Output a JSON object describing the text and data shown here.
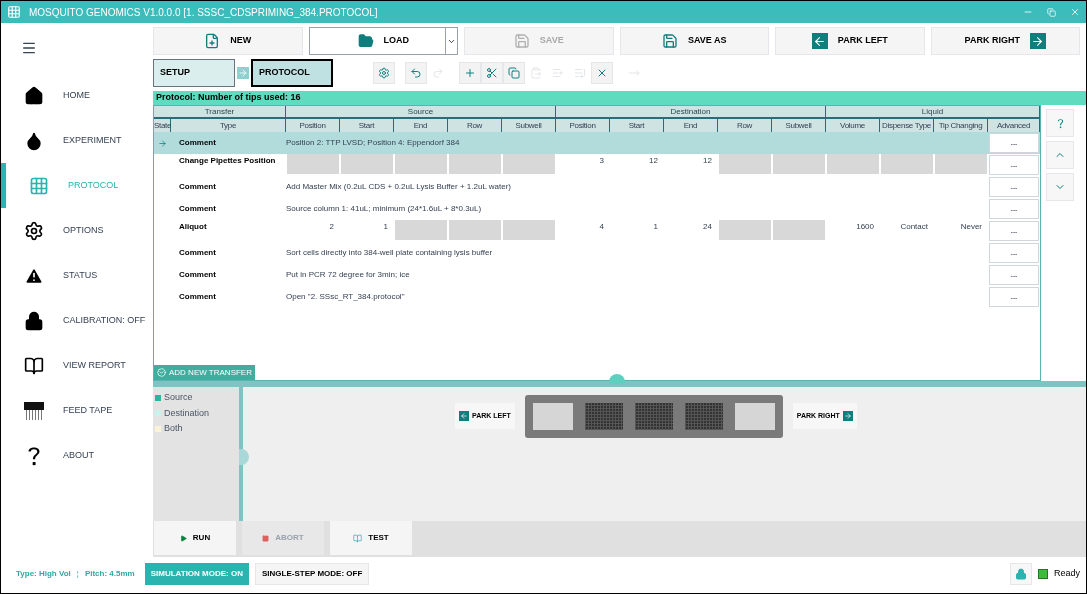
{
  "window": {
    "title": "MOSQUITO GENOMICS V1.0.0.0 [1. SSSC_CDSPRIMING_384.PROTOCOL]"
  },
  "sidebar": {
    "items": [
      {
        "label": "HOME",
        "selected": false
      },
      {
        "label": "EXPERIMENT",
        "selected": false
      },
      {
        "label": "PROTOCOL",
        "selected": true
      },
      {
        "label": "OPTIONS",
        "selected": false
      },
      {
        "label": "STATUS",
        "selected": false
      },
      {
        "label": "CALIBRATION: OFF",
        "selected": false
      },
      {
        "label": "VIEW REPORT",
        "selected": false
      },
      {
        "label": "FEED TAPE",
        "selected": false
      },
      {
        "label": "ABOUT",
        "selected": false
      }
    ]
  },
  "file_buttons": [
    {
      "label": "NEW",
      "disabled": false,
      "dropdown": false
    },
    {
      "label": "LOAD",
      "disabled": false,
      "dropdown": true
    },
    {
      "label": "SAVE",
      "disabled": true,
      "dropdown": false
    },
    {
      "label": "SAVE AS",
      "disabled": false,
      "dropdown": false
    },
    {
      "label": "PARK LEFT",
      "disabled": false,
      "dropdown": false
    },
    {
      "label": "PARK RIGHT",
      "disabled": false,
      "dropdown": false
    }
  ],
  "steps": [
    {
      "label": "SETUP",
      "selected": false
    },
    {
      "label": "PROTOCOL",
      "selected": true
    }
  ],
  "edit_tools": [
    {
      "disabled": false
    },
    {
      "disabled": false
    },
    {
      "disabled": true
    },
    {
      "disabled": false
    },
    {
      "disabled": false
    },
    {
      "disabled": false
    },
    {
      "disabled": true
    },
    {
      "disabled": true
    },
    {
      "disabled": true
    },
    {
      "disabled": false
    },
    {
      "disabled": true
    }
  ],
  "protocol": {
    "title": "Protocol: Number of tips used: 16",
    "groups": [
      "Transfer",
      "Source",
      "Destination",
      "Liquid"
    ],
    "columns": [
      "State",
      "Type",
      "Position",
      "Start",
      "End",
      "Row",
      "Subwell",
      "Position",
      "Start",
      "End",
      "Row",
      "Subwell",
      "Volume",
      "Dispense Type",
      "Tip Changing",
      "Advanced"
    ],
    "rows": [
      {
        "kind": "comment",
        "type": "Comment",
        "selected": true,
        "text": "Position 2: TTP LVSD; Position 4: Eppendorf 384",
        "advanced": "..."
      },
      {
        "kind": "transfer",
        "type": "Change Pipettes Position",
        "selected": false,
        "advanced": "...",
        "cells": [
          {
            "kind": "disabled"
          },
          {
            "kind": "disabled"
          },
          {
            "kind": "disabled"
          },
          {
            "kind": "disabled"
          },
          {
            "kind": "disabled"
          },
          {
            "kind": "value",
            "text": "3"
          },
          {
            "kind": "value",
            "text": "12"
          },
          {
            "kind": "value",
            "text": "12"
          },
          {
            "kind": "disabled"
          },
          {
            "kind": "disabled"
          },
          {
            "kind": "disabled"
          },
          {
            "kind": "disabled"
          },
          {
            "kind": "disabled"
          }
        ]
      },
      {
        "kind": "comment",
        "type": "Comment",
        "selected": false,
        "text": "Add Master Mix (0.2uL CDS + 0.2uL Lysis Buffer + 1.2uL water)",
        "advanced": "..."
      },
      {
        "kind": "comment",
        "type": "Comment",
        "selected": false,
        "text": "Source column 1: 41uL; minimum (24*1.6uL + 8*0.3uL)",
        "advanced": "..."
      },
      {
        "kind": "transfer",
        "type": "Aliquot",
        "selected": false,
        "advanced": "...",
        "cells": [
          {
            "kind": "value",
            "text": "2"
          },
          {
            "kind": "value",
            "text": "1"
          },
          {
            "kind": "disabled"
          },
          {
            "kind": "disabled"
          },
          {
            "kind": "disabled"
          },
          {
            "kind": "value",
            "text": "4"
          },
          {
            "kind": "value",
            "text": "1"
          },
          {
            "kind": "value",
            "text": "24"
          },
          {
            "kind": "disabled"
          },
          {
            "kind": "disabled"
          },
          {
            "kind": "value",
            "text": "1600"
          },
          {
            "kind": "value",
            "text": "Contact"
          },
          {
            "kind": "value",
            "text": "Never"
          }
        ]
      },
      {
        "kind": "comment",
        "type": "Comment",
        "selected": false,
        "text": "Sort cells directly into 384-well plate containing lysis buffer",
        "advanced": "..."
      },
      {
        "kind": "comment",
        "type": "Comment",
        "selected": false,
        "text": "Put in PCR 72 degree for 3min; ice",
        "advanced": "..."
      },
      {
        "kind": "comment",
        "type": "Comment",
        "selected": false,
        "text": "Open \"2. SSsc_RT_384.protocol\"",
        "advanced": "..."
      }
    ],
    "add_transfer": "ADD NEW TRANSFER"
  },
  "legend": [
    {
      "label": "Source",
      "color": "#2bb5a0"
    },
    {
      "label": "Destination",
      "color": "#c9f2ec"
    },
    {
      "label": "Both",
      "color": "#fbf3d9"
    }
  ],
  "deck": {
    "park_left": "PARK LEFT",
    "park_right": "PARK RIGHT",
    "positions": [
      {
        "kind": "empty"
      },
      {
        "kind": "plate"
      },
      {
        "kind": "plate"
      },
      {
        "kind": "plate"
      },
      {
        "kind": "empty"
      }
    ]
  },
  "run_buttons": [
    {
      "label": "RUN",
      "disabled": false
    },
    {
      "label": "ABORT",
      "disabled": true
    },
    {
      "label": "TEST",
      "disabled": false
    }
  ],
  "status_bar": {
    "type": "Type: High Vol",
    "separator": "¦",
    "pitch": "Pitch: 4.5mm",
    "modes": [
      {
        "label": "SIMULATION MODE: ON",
        "on": true
      },
      {
        "label": "SINGLE-STEP MODE: OFF",
        "on": false
      }
    ],
    "status": "Ready"
  }
}
